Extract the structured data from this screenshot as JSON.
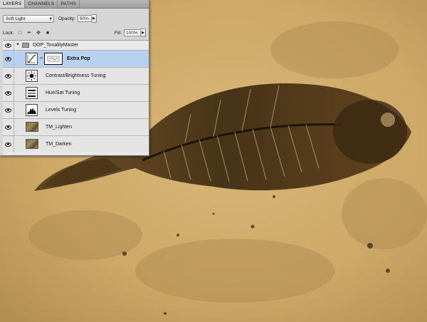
{
  "panel": {
    "tabs": [
      "LAYERS",
      "CHANNELS",
      "PATHS"
    ],
    "blend_mode": "Soft Light",
    "opacity_label": "Opacity:",
    "opacity_value": "50%",
    "lock_label": "Lock:",
    "fill_label": "Fill:",
    "fill_value": "100%"
  },
  "layers": [
    {
      "name": "DOP_TonalityMaster",
      "kind": "group",
      "selected": false
    },
    {
      "name": "Extra Pop",
      "kind": "adjustment",
      "icon": "curves-icon",
      "selected": true
    },
    {
      "name": "Contrast/Brightness Tuning",
      "kind": "adjustment",
      "icon": "brightness-icon",
      "selected": false
    },
    {
      "name": "Hue/Sat Tuning",
      "kind": "adjustment",
      "icon": "hue-sat-icon",
      "selected": false
    },
    {
      "name": "Levels Tuning",
      "kind": "adjustment",
      "icon": "levels-icon",
      "selected": false
    },
    {
      "name": "TM_Lighten",
      "kind": "pixel",
      "selected": false
    },
    {
      "name": "TM_Darken",
      "kind": "pixel",
      "selected": false
    }
  ],
  "colors": {
    "stone": "#c9a96a",
    "fossil_dark": "#3a2a14",
    "selection": "#b7d1ee"
  }
}
